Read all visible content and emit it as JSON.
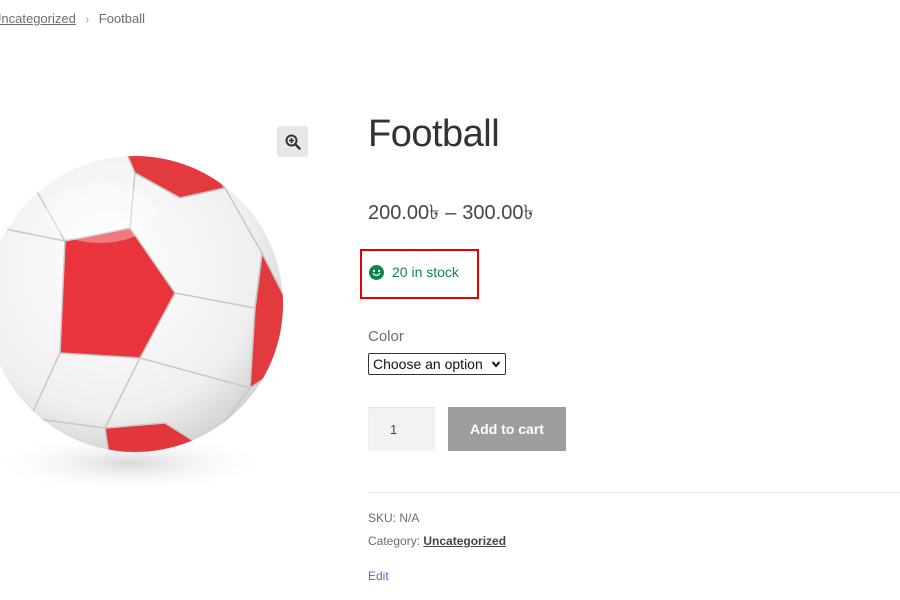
{
  "breadcrumb": {
    "parent": "Uncategorized",
    "current": "Football",
    "separator": "›"
  },
  "gallery": {
    "image_icon": "soccer-ball-image",
    "zoom_icon": "magnifier-zoom-icon"
  },
  "product": {
    "title": "Football",
    "price_min": "200.00৳",
    "price_dash": "–",
    "price_max": "300.00৳",
    "stock_text": "20 in stock",
    "stock_icon": "smiley-icon",
    "stock_color": "#0f834d",
    "highlight_color": "#e00000"
  },
  "variation": {
    "label": "Color",
    "selected": "Choose an option"
  },
  "cart": {
    "quantity": "1",
    "add_label": "Add to cart",
    "button_color": "#9d9d9d"
  },
  "meta": {
    "sku_label": "SKU:",
    "sku_value": "N/A",
    "category_label": "Category:",
    "category_value": "Uncategorized"
  },
  "admin": {
    "edit_label": "Edit",
    "edit_color": "#7f54b3"
  }
}
